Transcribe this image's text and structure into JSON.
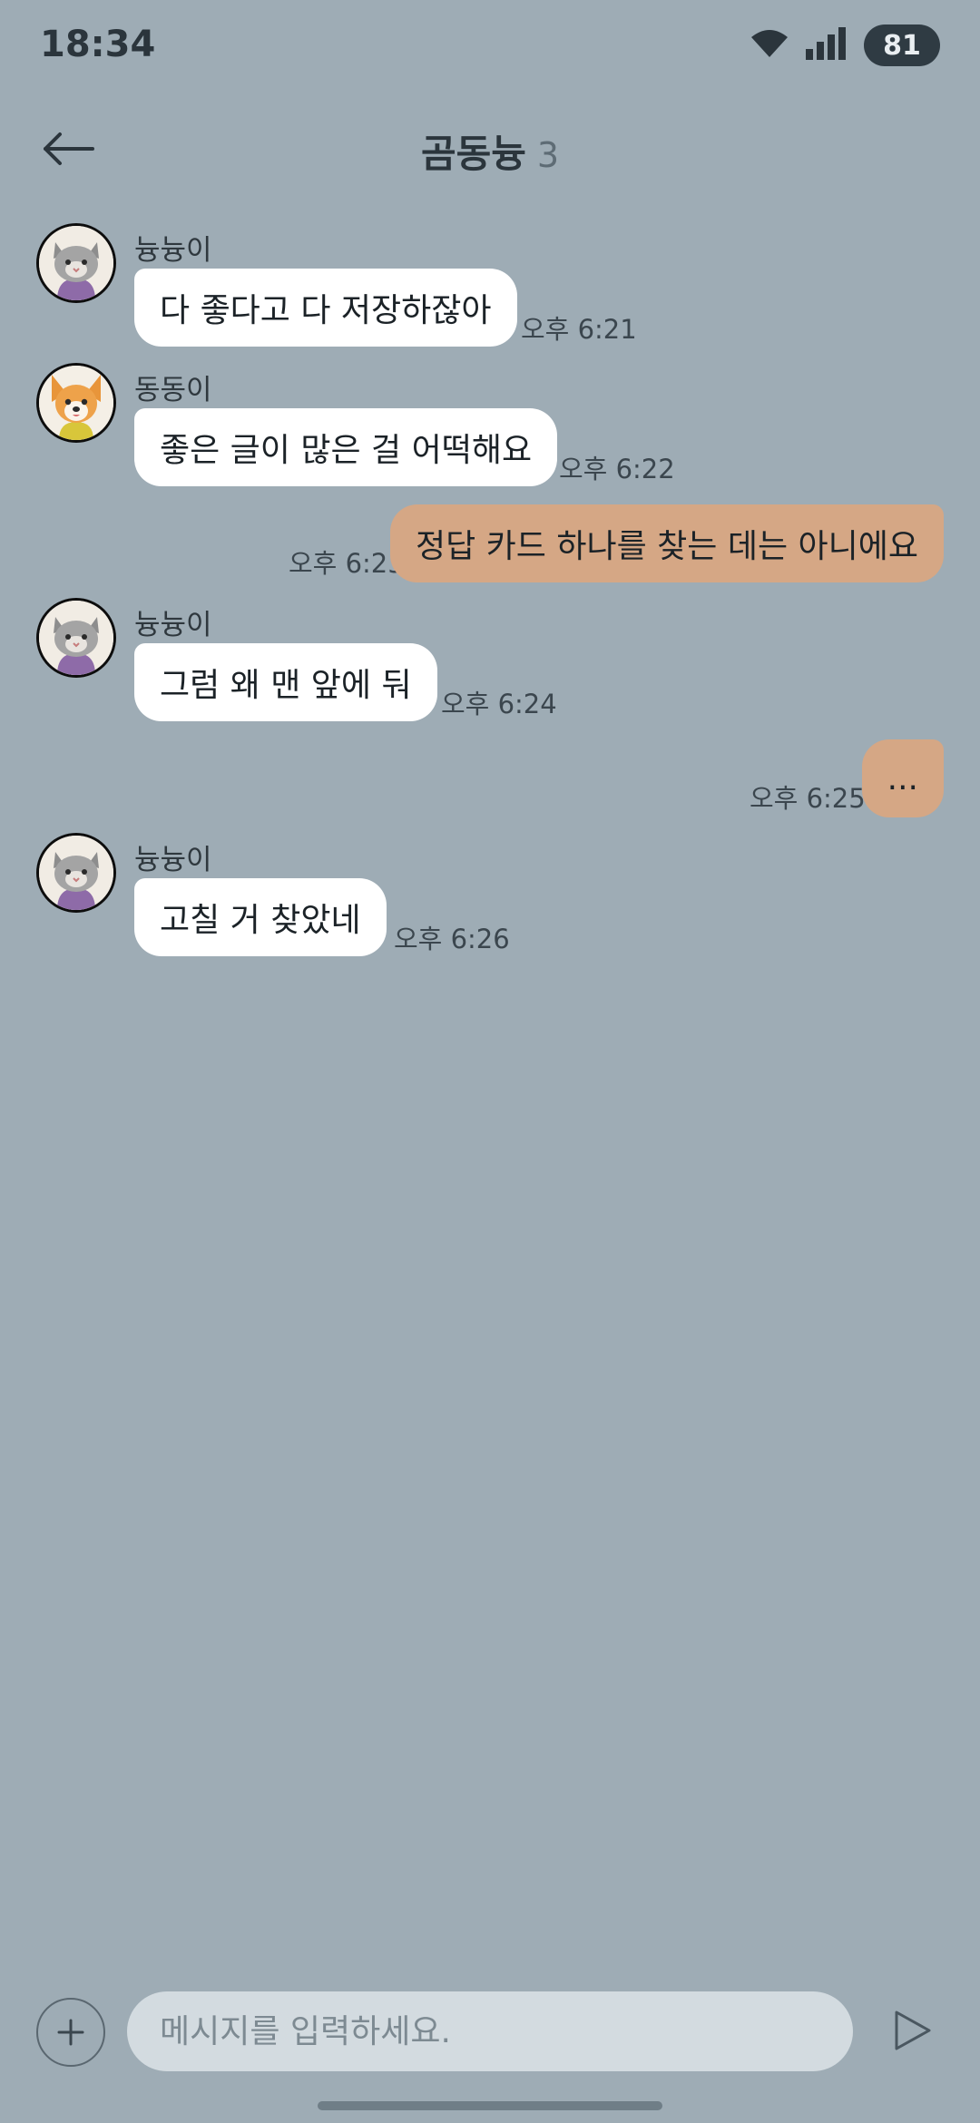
{
  "status_bar": {
    "time": "18:34",
    "battery": "81",
    "icons": [
      "wifi-icon",
      "signal-icon",
      "battery-icon"
    ]
  },
  "header": {
    "title": "곰동늉",
    "member_count": "3",
    "back_icon": "back-arrow-icon"
  },
  "messages": [
    {
      "direction": "in",
      "sender": "늉늉이",
      "avatar": "cat-avatar",
      "text": "다 좋다고 다 저장하잖아",
      "time": "오후 6:21"
    },
    {
      "direction": "in",
      "sender": "동동이",
      "avatar": "dog-avatar",
      "text": "좋은 글이 많은 걸 어떡해요",
      "time": "오후 6:22"
    },
    {
      "direction": "out",
      "text": "정답 카드 하나를 찾는 데는 아니에요",
      "time": "오후 6:23"
    },
    {
      "direction": "in",
      "sender": "늉늉이",
      "avatar": "cat-avatar",
      "text": "그럼 왜 맨 앞에 둬",
      "time": "오후 6:24"
    },
    {
      "direction": "out",
      "text": "...",
      "time": "오후 6:25"
    },
    {
      "direction": "in",
      "sender": "늉늉이",
      "avatar": "cat-avatar",
      "text": "고칠 거 찾았네",
      "time": "오후 6:26"
    }
  ],
  "input": {
    "placeholder": "메시지를 입력하세요.",
    "value": "",
    "plus_icon": "plus-icon",
    "send_icon": "send-icon"
  },
  "colors": {
    "background": "#9eacb5",
    "incoming_bubble": "#ffffff",
    "outgoing_bubble": "#d5a785",
    "input_field": "#d3dbe0"
  }
}
